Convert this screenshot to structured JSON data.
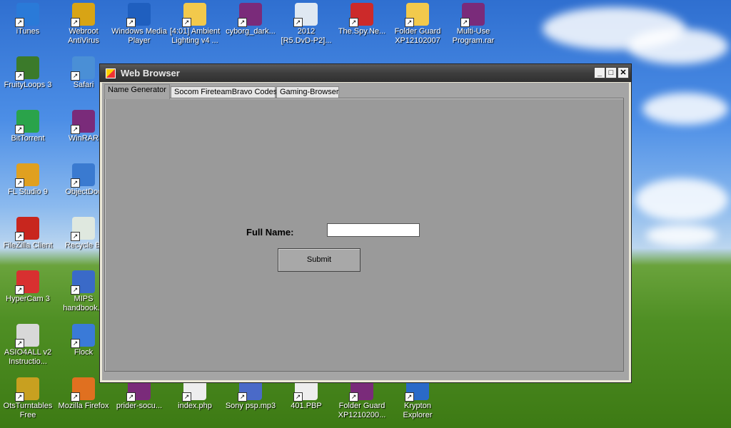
{
  "desktop": {
    "icons": [
      {
        "label": "iTunes",
        "color": "#2a7ad8"
      },
      {
        "label": "Webroot\nAntiVirus",
        "color": "#d8a415"
      },
      {
        "label": "Windows Media\nPlayer",
        "color": "#1f5fbf"
      },
      {
        "label": "[4:01] Ambient\nLighting v4 ...",
        "color": "#f2c94c"
      },
      {
        "label": "cyborg_dark...",
        "color": "#7a2b7a"
      },
      {
        "label": "2012\n[R5.DvD-P2]...",
        "color": "#dfe8f2"
      },
      {
        "label": "The.Spy.Ne...",
        "color": "#cc2a2a"
      },
      {
        "label": "Folder Guard\nXP12102007",
        "color": "#f2c94c"
      },
      {
        "label": "Multi-Use\nProgram.rar",
        "color": "#7a2b7a"
      },
      {
        "label": "FruityLoops 3",
        "color": "#3b7a2a"
      },
      {
        "label": "Safari",
        "color": "#4a8fd6"
      },
      {
        "label": "BitTorrent",
        "color": "#2aa34a"
      },
      {
        "label": "WinRAR",
        "color": "#7a2b7a"
      },
      {
        "label": "FL Studio 9",
        "color": "#e0a020"
      },
      {
        "label": "ObjectDoc",
        "color": "#3a7ad0"
      },
      {
        "label": "FileZilla Client",
        "color": "#c8261e"
      },
      {
        "label": "Recycle Bi",
        "color": "#dfe8df"
      },
      {
        "label": "HyperCam 3",
        "color": "#d83030"
      },
      {
        "label": "MIPS\nhandbook.d",
        "color": "#3a6ac8"
      },
      {
        "label": "ASIO4ALL v2\nInstructio...",
        "color": "#d8d8d8"
      },
      {
        "label": "Flock",
        "color": "#3a7ad8"
      },
      {
        "label": "OtsTurntables\nFree",
        "color": "#c8a020"
      },
      {
        "label": "Mozilla Firefox",
        "color": "#e07020"
      },
      {
        "label": "prider-socu...",
        "color": "#7a2b7a"
      },
      {
        "label": "index.php",
        "color": "#eeeeee"
      },
      {
        "label": "Sony psp.mp3",
        "color": "#4a6ac8"
      },
      {
        "label": "401.PBP",
        "color": "#eeeeee"
      },
      {
        "label": "Folder Guard\nXP1210200...",
        "color": "#7a2b7a"
      },
      {
        "label": "Krypton\nExplorer",
        "color": "#2a6ac8"
      }
    ]
  },
  "window": {
    "title": "Web Browser",
    "buttons": {
      "minimize": "_",
      "maximize": "□",
      "close": "✕"
    },
    "tabs": [
      {
        "label": "Name Generator",
        "active": true
      },
      {
        "label": "Socom FireteamBravo Codes",
        "active": false
      },
      {
        "label": "Gaming-Browser",
        "active": false
      }
    ],
    "form": {
      "full_name_label": "Full Name:",
      "full_name_value": "",
      "submit_label": "Submit"
    }
  }
}
